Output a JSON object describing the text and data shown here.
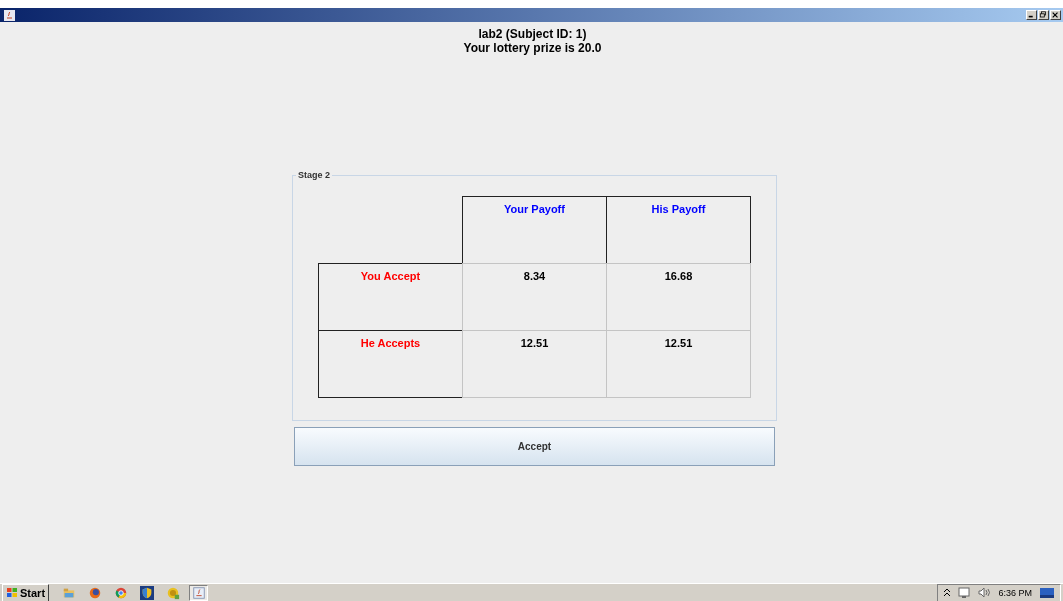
{
  "header": {
    "lines": [
      "lab2 (Subject ID: 1)",
      "Your lottery prize is 20.0"
    ]
  },
  "stage": {
    "title": "Stage 2",
    "columns": [
      "Your Payoff",
      "His Payoff"
    ],
    "rows": [
      {
        "label": "You Accept",
        "cells": [
          "8.34",
          "16.68"
        ]
      },
      {
        "label": "He Accepts",
        "cells": [
          "12.51",
          "12.51"
        ]
      }
    ]
  },
  "button": {
    "label": "Accept"
  },
  "taskbar": {
    "start": "Start",
    "apps": [
      {
        "kind": "folder",
        "selected": false
      },
      {
        "kind": "fox",
        "selected": false
      },
      {
        "kind": "browser",
        "selected": false
      },
      {
        "kind": "shield",
        "selected": false
      },
      {
        "kind": "coin",
        "selected": false
      },
      {
        "kind": "java",
        "selected": true
      }
    ],
    "clock": "6:36 PM"
  }
}
